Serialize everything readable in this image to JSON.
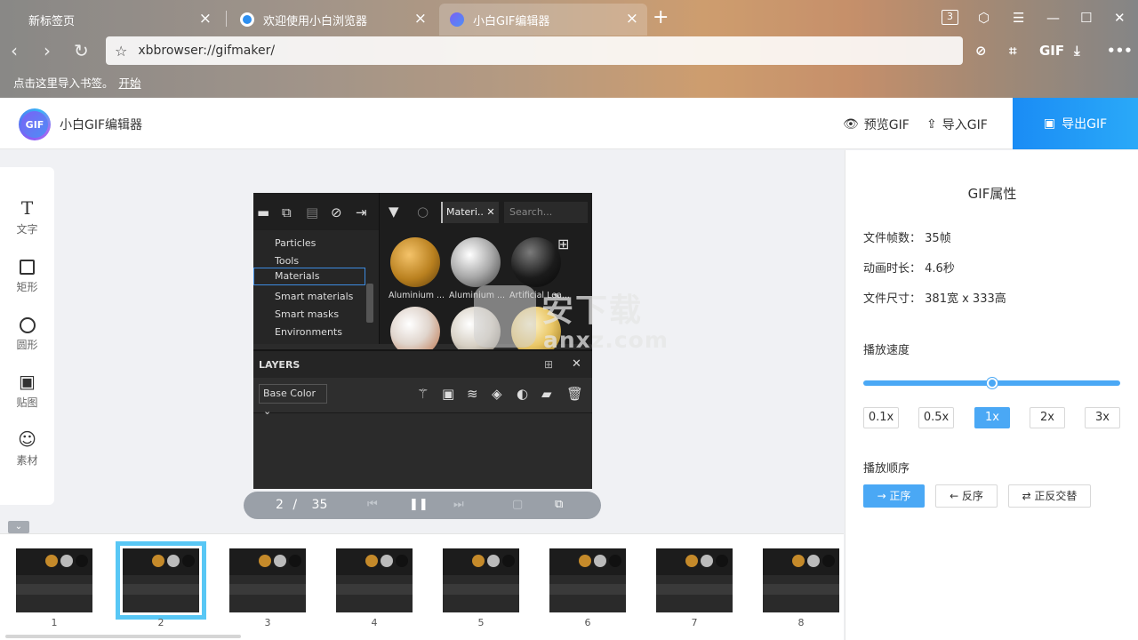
{
  "browser": {
    "tabs": [
      {
        "label": "新标签页",
        "active": false
      },
      {
        "label": "欢迎使用小白浏览器",
        "active": false
      },
      {
        "label": "小白GIF编辑器",
        "active": true
      }
    ],
    "tab_count": "3",
    "address": "xbbrowser://gifmaker/",
    "toolbar_gif_label": "GIF",
    "bookmark_prompt": "点击这里导入书签。",
    "bookmark_link": "开始"
  },
  "app": {
    "logo_text": "GIF",
    "title": "小白GIF编辑器",
    "preview_label": "预览GIF",
    "import_label": "导入GIF",
    "export_label": "导出GIF"
  },
  "tools": [
    {
      "label": "文字",
      "icon": "text-icon"
    },
    {
      "label": "矩形",
      "icon": "rectangle-icon"
    },
    {
      "label": "圆形",
      "icon": "circle-icon"
    },
    {
      "label": "贴图",
      "icon": "image-icon"
    },
    {
      "label": "素材",
      "icon": "smiley-icon"
    }
  ],
  "preview": {
    "tree": [
      "Particles",
      "Tools",
      "Materials",
      "Smart materials",
      "Smart masks",
      "Environments"
    ],
    "selected_tree": "Materials",
    "chip": "Materi..",
    "search_placeholder": "Search...",
    "thumb_labels": [
      "Aluminium ...",
      "Aluminium ...",
      "Artificial Lea..."
    ],
    "layers_title": "LAYERS",
    "layer_select": "Base Color",
    "watermark_main": "安下载",
    "watermark_sub": "anxz.com"
  },
  "playback": {
    "current": "2",
    "separator": "/",
    "total": "35"
  },
  "timeline": {
    "frames": [
      "1",
      "2",
      "3",
      "4",
      "5",
      "6",
      "7",
      "8"
    ],
    "selected": "2"
  },
  "properties": {
    "title": "GIF属性",
    "frames_label": "文件帧数：",
    "frames_value": "35帧",
    "duration_label": "动画时长：",
    "duration_value": "4.6秒",
    "size_label": "文件尺寸：",
    "size_value": "381宽 x 333高",
    "speed_title": "播放速度",
    "speed_fraction": 0.5,
    "speeds": [
      "0.1x",
      "0.5x",
      "1x",
      "2x",
      "3x"
    ],
    "active_speed": "1x",
    "order_title": "播放顺序",
    "orders": [
      "→ 正序",
      "← 反序",
      "⇄ 正反交替"
    ],
    "active_order": "→ 正序"
  },
  "colors": {
    "accent": "#4aa8f5",
    "export_bg": "#1a8cf5",
    "selected_frame": "#58c7f5"
  }
}
